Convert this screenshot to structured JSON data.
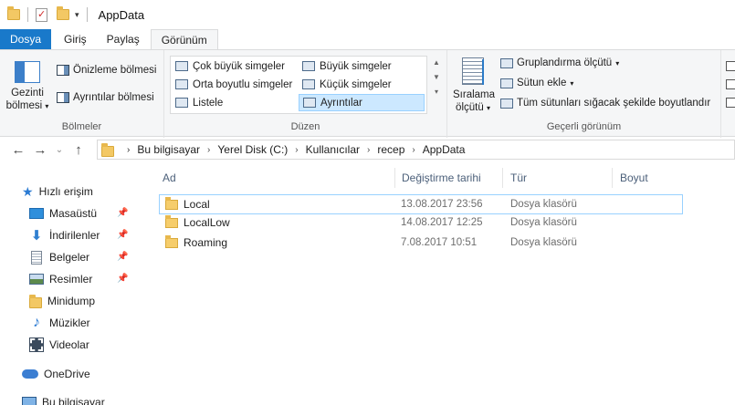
{
  "window": {
    "title": "AppData"
  },
  "tabs": [
    "Dosya",
    "Giriş",
    "Paylaş",
    "Görünüm"
  ],
  "ribbon": {
    "panes": {
      "nav_pane_line1": "Gezinti",
      "nav_pane_line2": "bölmesi",
      "preview_pane": "Önizleme bölmesi",
      "details_pane": "Ayrıntılar bölmesi",
      "group_label": "Bölmeler"
    },
    "layout": {
      "items": [
        "Çok büyük simgeler",
        "Büyük simgeler",
        "Orta boyutlu simgeler",
        "Küçük simgeler",
        "Listele",
        "Ayrıntılar"
      ],
      "selected": "Ayrıntılar",
      "group_label": "Düzen"
    },
    "current_view": {
      "sort_line1": "Sıralama",
      "sort_line2": "ölçütü",
      "group_by": "Gruplandırma ölçütü",
      "add_column": "Sütun ekle",
      "fit_columns": "Tüm sütunları sığacak şekilde boyutlandır",
      "group_label": "Geçerli görünüm"
    }
  },
  "address": {
    "crumbs": [
      "Bu bilgisayar",
      "Yerel Disk (C:)",
      "Kullanıcılar",
      "recep",
      "AppData"
    ]
  },
  "nav": {
    "quick_access": "Hızlı erişim",
    "items": [
      {
        "label": "Masaüstü",
        "pinned": true
      },
      {
        "label": "İndirilenler",
        "pinned": true
      },
      {
        "label": "Belgeler",
        "pinned": true
      },
      {
        "label": "Resimler",
        "pinned": true
      },
      {
        "label": "Minidump",
        "pinned": false
      },
      {
        "label": "Müzikler",
        "pinned": false
      },
      {
        "label": "Videolar",
        "pinned": false
      }
    ],
    "onedrive": "OneDrive",
    "this_pc": "Bu bilgisayar"
  },
  "files": {
    "columns": [
      "Ad",
      "Değiştirme tarihi",
      "Tür",
      "Boyut"
    ],
    "rows": [
      {
        "name": "Local",
        "modified": "13.08.2017 23:56",
        "type": "Dosya klasörü",
        "size": ""
      },
      {
        "name": "LocalLow",
        "modified": "14.08.2017 12:25",
        "type": "Dosya klasörü",
        "size": ""
      },
      {
        "name": "Roaming",
        "modified": "7.08.2017 10:51",
        "type": "Dosya klasörü",
        "size": ""
      }
    ]
  },
  "colors": {
    "file_tab": "#1979ca",
    "selection_border": "#99d1ff",
    "selection_fill": "#cce8ff"
  }
}
